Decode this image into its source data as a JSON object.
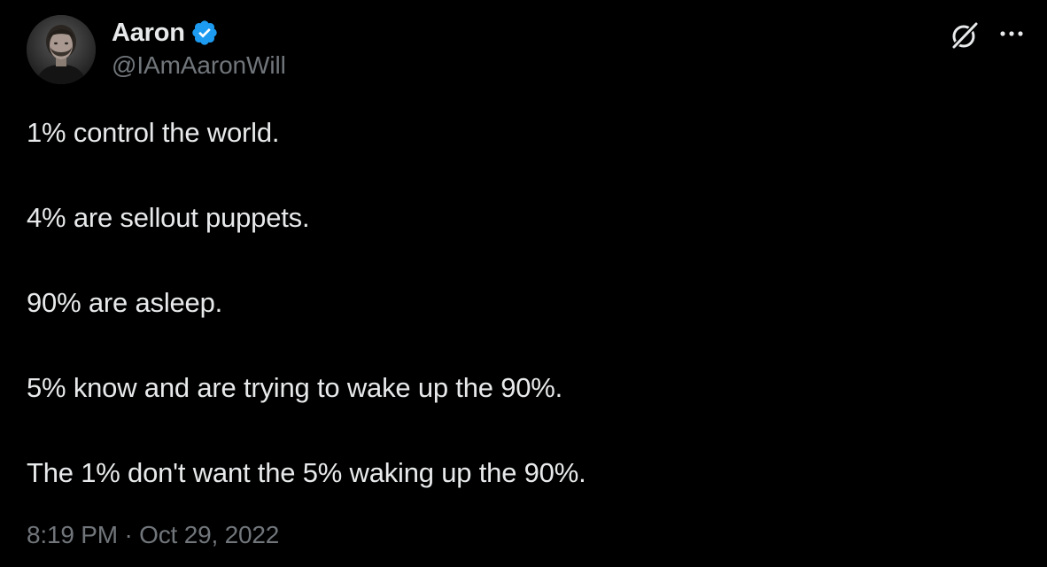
{
  "author": {
    "display_name": "Aaron",
    "handle": "@IAmAaronWill",
    "verified": true,
    "verified_color": "#1d9bf0"
  },
  "icons": {
    "avatar": "avatar",
    "verified": "verified-badge-icon",
    "grok": "grok-icon",
    "more": "more-icon"
  },
  "tweet": {
    "lines": [
      "1% control the world.",
      "4% are sellout puppets.",
      "90% are asleep.",
      "5% know and are trying to wake up the 90%.",
      "The 1% don't want the 5% waking up the 90%."
    ],
    "timestamp": "8:19 PM · Oct 29, 2022"
  },
  "colors": {
    "background": "#000000",
    "primary_text": "#e7e9ea",
    "secondary_text": "#71767b"
  }
}
